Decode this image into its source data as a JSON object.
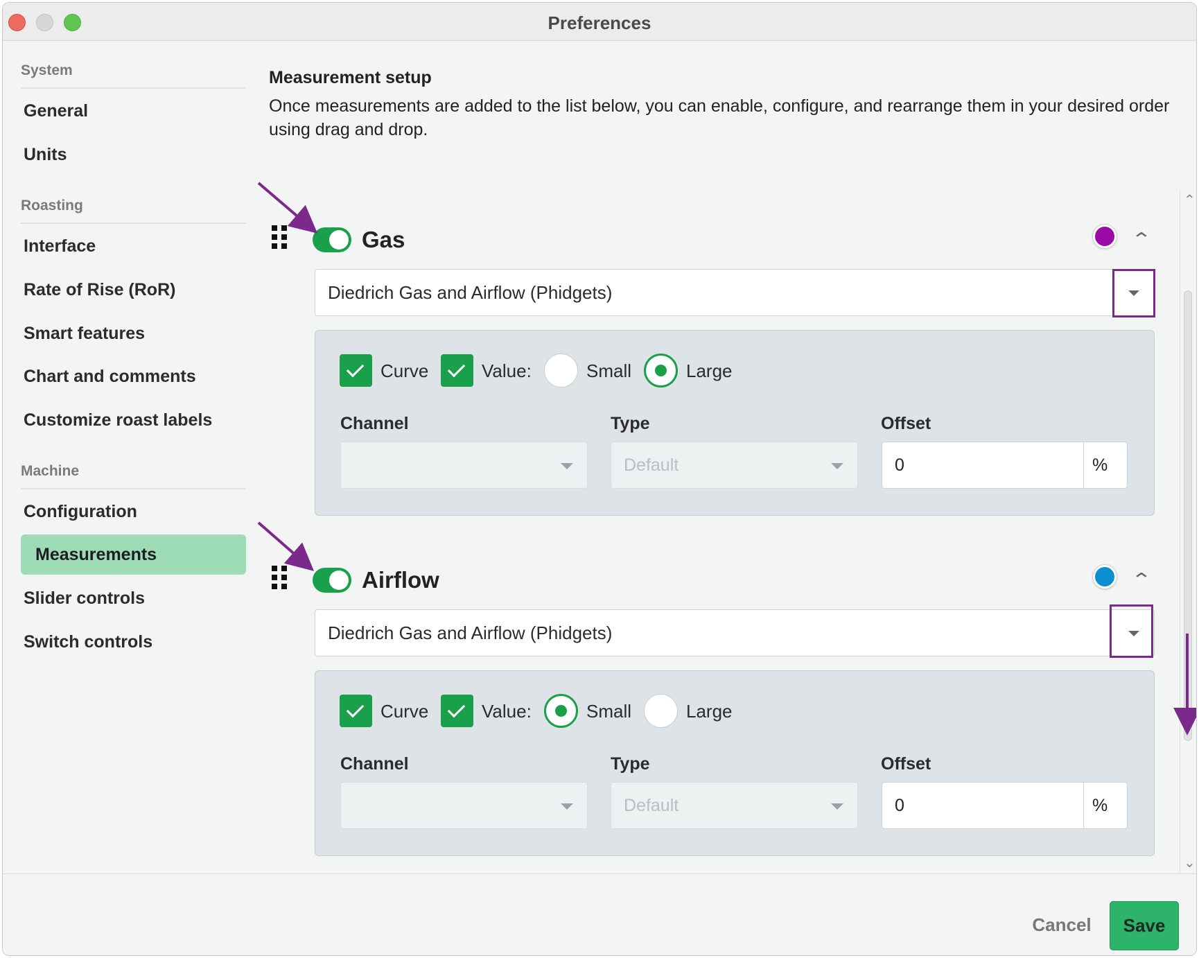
{
  "window": {
    "title": "Preferences"
  },
  "sidebar": {
    "sections": [
      {
        "label": "System",
        "items": [
          "General",
          "Units"
        ]
      },
      {
        "label": "Roasting",
        "items": [
          "Interface",
          "Rate of Rise (RoR)",
          "Smart features",
          "Chart and comments",
          "Customize roast labels"
        ]
      },
      {
        "label": "Machine",
        "items": [
          "Configuration",
          "Measurements",
          "Slider controls",
          "Switch controls"
        ]
      }
    ],
    "active_item": "Measurements"
  },
  "main": {
    "title": "Measurement setup",
    "description": "Once measurements are added to the list below, you can enable, configure, and rearrange them in your desired order using drag and drop."
  },
  "measurements": [
    {
      "name": "Gas",
      "enabled": true,
      "color": "#9b0aa6",
      "device": "Diedrich Gas and Airflow (Phidgets)",
      "curve_label": "Curve",
      "curve_checked": true,
      "value_label": "Value:",
      "value_checked": true,
      "size_small_label": "Small",
      "size_large_label": "Large",
      "size_selected": "Large",
      "channel_label": "Channel",
      "channel_value": "",
      "type_label": "Type",
      "type_value": "Default",
      "offset_label": "Offset",
      "offset_value": "0",
      "offset_unit": "%"
    },
    {
      "name": "Airflow",
      "enabled": true,
      "color": "#0b8fd0",
      "device": "Diedrich Gas and Airflow (Phidgets)",
      "curve_label": "Curve",
      "curve_checked": true,
      "value_label": "Value:",
      "value_checked": true,
      "size_small_label": "Small",
      "size_large_label": "Large",
      "size_selected": "Small",
      "channel_label": "Channel",
      "channel_value": "",
      "type_label": "Type",
      "type_value": "Default",
      "offset_label": "Offset",
      "offset_value": "0",
      "offset_unit": "%"
    }
  ],
  "footer": {
    "cancel_label": "Cancel",
    "save_label": "Save"
  },
  "colors": {
    "accent_green": "#1aa04a",
    "sidebar_active": "#9ddcb7",
    "annotation_purple": "#7b2a8c"
  },
  "icons": {
    "drag_handle": "drag-handle-icon",
    "collapse": "chevron-up-icon",
    "dropdown": "chevron-down-icon"
  }
}
